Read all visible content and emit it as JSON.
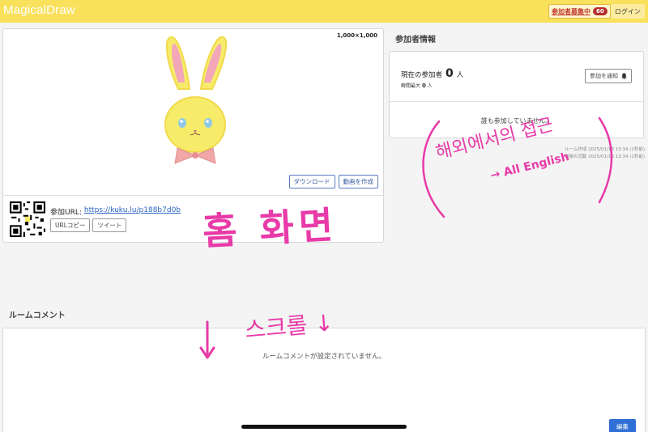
{
  "header": {
    "logo": "MagicalDraw",
    "recruit_label": "参加者募集中",
    "recruit_count": "60",
    "login_label": "ログイン",
    "bg_color": "#f9e15c"
  },
  "canvas": {
    "size_label": "1,000×1,000",
    "download_label": "ダウンロード",
    "make_video_label": "動画を作成",
    "join_url_label": "参加URL:",
    "join_url": "https://kuku.lu/p188b7d0b",
    "copy_url_label": "URLコピー",
    "tweet_label": "ツイート"
  },
  "participants": {
    "title": "参加者情報",
    "current_label": "現在の参加者",
    "current_count": "0",
    "current_unit": "人",
    "peak_label": "瞬間最大",
    "peak_count": "0",
    "peak_unit": "人",
    "notify_label": "参加を通知",
    "empty_message": "誰も参加していません。",
    "room_created": "ルーム作成 2025/01/18 13:34 (1秒前)",
    "last_activity": "最後の活動 2025/01/18 13:34 (1秒前)"
  },
  "room_comment": {
    "title": "ルームコメント",
    "empty_message": "ルームコメントが設定されていません。",
    "edit_label": "編集"
  },
  "annotations": {
    "home_screen": "홈 화면",
    "overseas_access": "해외에서의 접근",
    "all_english": "→ All English",
    "scroll": "스크롤 ↓"
  },
  "colors": {
    "annotation_pink": "#e83aa8",
    "link_blue": "#2c63c4",
    "primary_button": "#2f6fd6"
  }
}
